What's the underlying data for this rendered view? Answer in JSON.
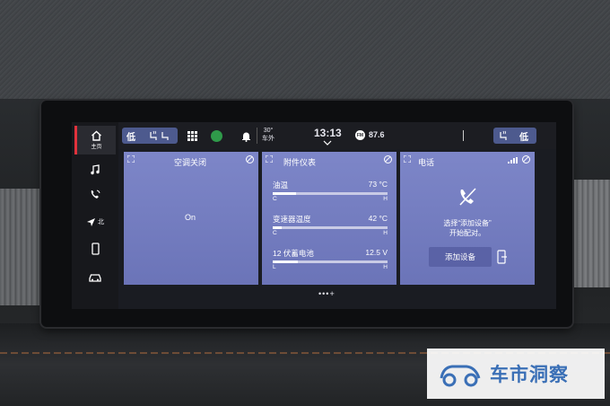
{
  "sidebar": {
    "items": [
      {
        "icon": "home-icon",
        "label": "主页",
        "active": true
      },
      {
        "icon": "music-icon"
      },
      {
        "icon": "phone-call-icon"
      },
      {
        "icon": "navigation-icon",
        "label": "北"
      },
      {
        "icon": "phone-device-icon"
      },
      {
        "icon": "car-icon"
      }
    ]
  },
  "topbar": {
    "fan_left_label": "低",
    "temp_value": "30°",
    "temp_label": "车外",
    "time": "13:13",
    "radio_band": "FM",
    "radio_freq": "87.6",
    "fan_right_label": "低"
  },
  "cards": {
    "climate": {
      "title": "空调关闭",
      "status": "On"
    },
    "gauges": {
      "title": "附件仪表",
      "items": [
        {
          "name": "油温",
          "value": "73 °C",
          "low": "C",
          "high": "H",
          "level": 0.2
        },
        {
          "name": "变速器温度",
          "value": "42 °C",
          "low": "C",
          "high": "H",
          "level": 0.08
        },
        {
          "name": "12 伏蓄电池",
          "value": "12.5 V",
          "low": "L",
          "high": "H",
          "level": 0.22
        }
      ]
    },
    "phone": {
      "title": "电话",
      "message_line1": "选择“添加设备”",
      "message_line2": "开始配对。",
      "add_button": "添加设备"
    }
  },
  "pager": "•••+",
  "watermark": "车市洞察",
  "colors": {
    "card": "#7d86c8",
    "accent_red": "#e0323c",
    "chip": "#4d5a8e",
    "watermark": "#3a6fb6"
  }
}
